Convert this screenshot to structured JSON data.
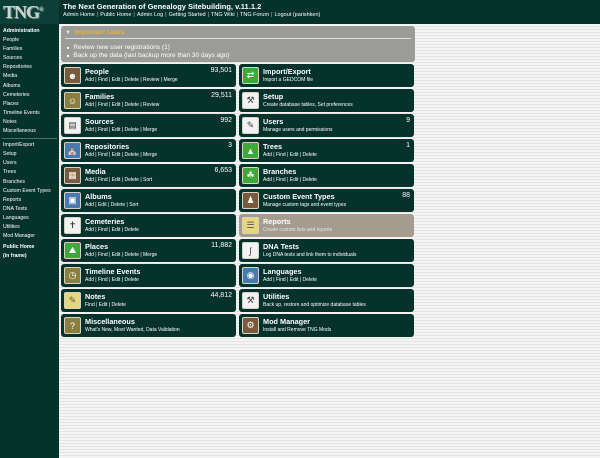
{
  "header": {
    "logo": "TNG",
    "logo_mark": "®",
    "title": "The Next Generation of Genealogy Sitebuilding, v.11.1.2",
    "links": [
      "Admin Home",
      "Public Home",
      "Admin Log",
      "Getting Started",
      "TNG Wiki",
      "TNG Forum",
      "Logout  (parishken)"
    ],
    "separator": "|"
  },
  "sidebar": {
    "group1": [
      "Administration",
      "People",
      "Families",
      "Sources",
      "Repositories",
      "Media",
      "Albums",
      "Cemeteries",
      "Places",
      "Timeline Events",
      "Notes",
      "Miscellaneous"
    ],
    "group2": [
      "Import/Export",
      "Setup",
      "Users",
      "Trees",
      "Branches",
      "Custom Event Types",
      "Reports",
      "DNA Tests",
      "Languages",
      "Utilities",
      "Mod Manager"
    ],
    "public_home_1": "Public Home",
    "public_home_2": "(in frame)"
  },
  "tasks": {
    "heading": "Important tasks",
    "items": [
      "Review new user registrations (1)",
      "Back up the data (last backup more than 30 days ago)"
    ]
  },
  "tiles": {
    "people": {
      "title": "People",
      "sub": "Add | Find | Edit | Delete | Review | Merge",
      "count": "93,501"
    },
    "import_export": {
      "title": "Import/Export",
      "sub": "Import a GEDCOM file"
    },
    "families": {
      "title": "Families",
      "sub": "Add | Find | Edit | Delete | Review",
      "count": "29,511"
    },
    "setup": {
      "title": "Setup",
      "sub": "Create database tables, Set preferences"
    },
    "sources": {
      "title": "Sources",
      "sub": "Add | Find | Edit | Delete | Merge",
      "count": "992"
    },
    "users": {
      "title": "Users",
      "sub": "Manage users and permissions",
      "count": "9"
    },
    "repositories": {
      "title": "Repositories",
      "sub": "Add | Find | Edit | Delete | Merge",
      "count": "3"
    },
    "trees": {
      "title": "Trees",
      "sub": "Add | Find | Edit | Delete",
      "count": "1"
    },
    "media": {
      "title": "Media",
      "sub": "Add | Find | Edit | Delete | Sort",
      "count": "6,653"
    },
    "branches": {
      "title": "Branches",
      "sub": "Add | Find | Edit | Delete"
    },
    "albums": {
      "title": "Albums",
      "sub": "Add | Edit | Delete | Sort"
    },
    "custom_events": {
      "title": "Custom Event Types",
      "sub": "Manage custom tags and event types",
      "count": "88"
    },
    "cemeteries": {
      "title": "Cemeteries",
      "sub": "Add | Find | Edit | Delete"
    },
    "reports": {
      "title": "Reports",
      "sub": "Create custom lists and reports"
    },
    "places": {
      "title": "Places",
      "sub": "Add | Find | Edit | Delete | Merge",
      "count": "11,882"
    },
    "dna_tests": {
      "title": "DNA Tests",
      "sub": "Log DNA tests and link them to individuals"
    },
    "timeline": {
      "title": "Timeline Events",
      "sub": "Add | Find | Edit | Delete"
    },
    "languages": {
      "title": "Languages",
      "sub": "Add | Find | Edit | Delete"
    },
    "notes": {
      "title": "Notes",
      "sub": "Find | Edit | Delete",
      "count": "44,812"
    },
    "utilities": {
      "title": "Utilities",
      "sub": "Back up, restore and optimize database tables"
    },
    "misc": {
      "title": "Miscellaneous",
      "sub": "What's New, Most Wanted, Data Validation"
    },
    "mod_manager": {
      "title": "Mod Manager",
      "sub": "Install and Remove TNG Mods"
    }
  },
  "icons": {
    "people": "people-photo-icon",
    "import_export": "arrows-icon",
    "families": "family-photo-icon",
    "setup": "hammer-icon",
    "sources": "document-icon",
    "users": "user-card-icon",
    "repositories": "building-icon",
    "trees": "tree-icon",
    "media": "film-icon",
    "branches": "tree-branch-icon",
    "albums": "album-icon",
    "custom_events": "portrait-icon",
    "cemeteries": "headstone-icon",
    "reports": "clipboard-icon",
    "places": "landscape-icon",
    "dna_tests": "dna-icon",
    "timeline": "clock-icon",
    "languages": "globe-icon",
    "notes": "note-icon",
    "utilities": "toolbox-icon",
    "misc": "question-icon",
    "mod_manager": "gears-icon"
  },
  "colors": {
    "dark_green": "#05322b",
    "task_gold": "#e8b23a",
    "task_gray": "#9b9b98",
    "reports_tile": "#a59c8f"
  }
}
